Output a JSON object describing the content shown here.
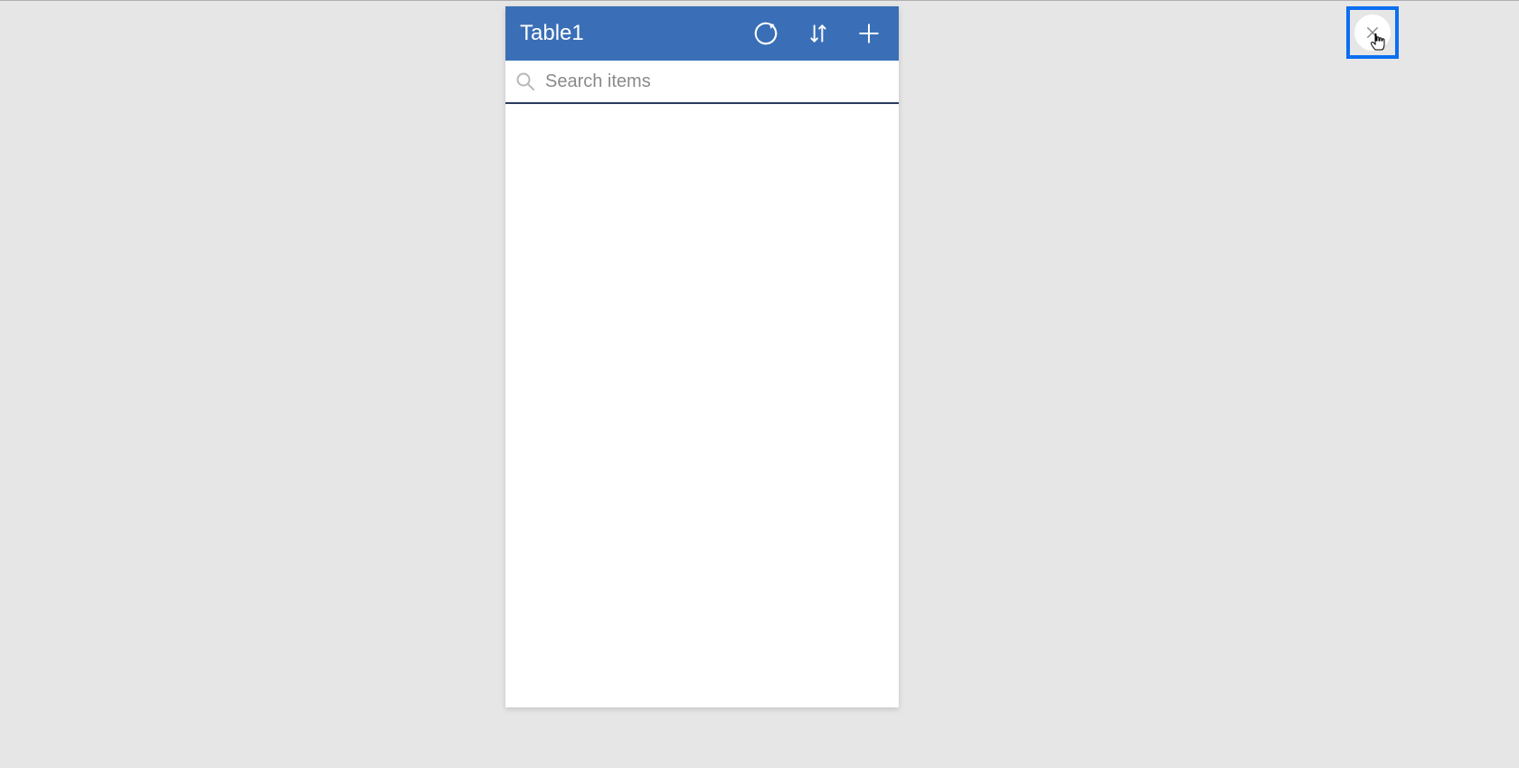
{
  "panel": {
    "title": "Table1",
    "search": {
      "placeholder": "Search items",
      "value": ""
    },
    "icons": {
      "refresh": "refresh",
      "sort": "sort",
      "add": "add"
    }
  },
  "close": {
    "icon": "close"
  },
  "colors": {
    "header": "#3a6fb7",
    "highlight": "#0a6ff0",
    "searchBorder": "#2b3a5e",
    "background": "#e6e6e6"
  }
}
